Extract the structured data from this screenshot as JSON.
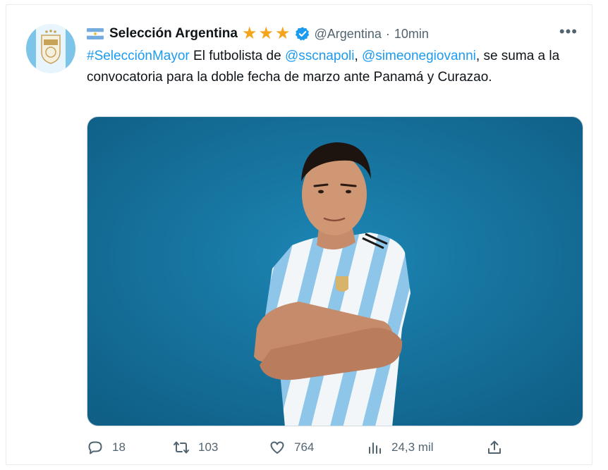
{
  "tweet": {
    "display_name": "Selección Argentina",
    "handle": "@Argentina",
    "time_sep": "·",
    "time": "10min",
    "more_label": "•••",
    "text": {
      "hashtag": "#SelecciónMayor",
      "part1": " El futbolista de ",
      "mention1": "@sscnapoli",
      "part2": ", ",
      "mention2": "@simeonegiovanni",
      "part3": ", se suma a la convocatoria para la doble fecha de marzo ante Panamá y Curazao."
    },
    "media": {
      "icon": "player-photo"
    }
  },
  "badges": {
    "flag_icon": "argentina-flag-icon",
    "star_icon": "star-icon",
    "stars": 3,
    "verified_icon": "verified-badge-icon"
  },
  "actions": {
    "replies": "18",
    "retweets": "103",
    "likes": "764",
    "views": "24,3 mil"
  },
  "colors": {
    "link": "#1d9bf0",
    "secondary": "#536471",
    "star": "#f4a51c",
    "verified": "#1d9bf0",
    "photo_bg": "#16739e"
  }
}
